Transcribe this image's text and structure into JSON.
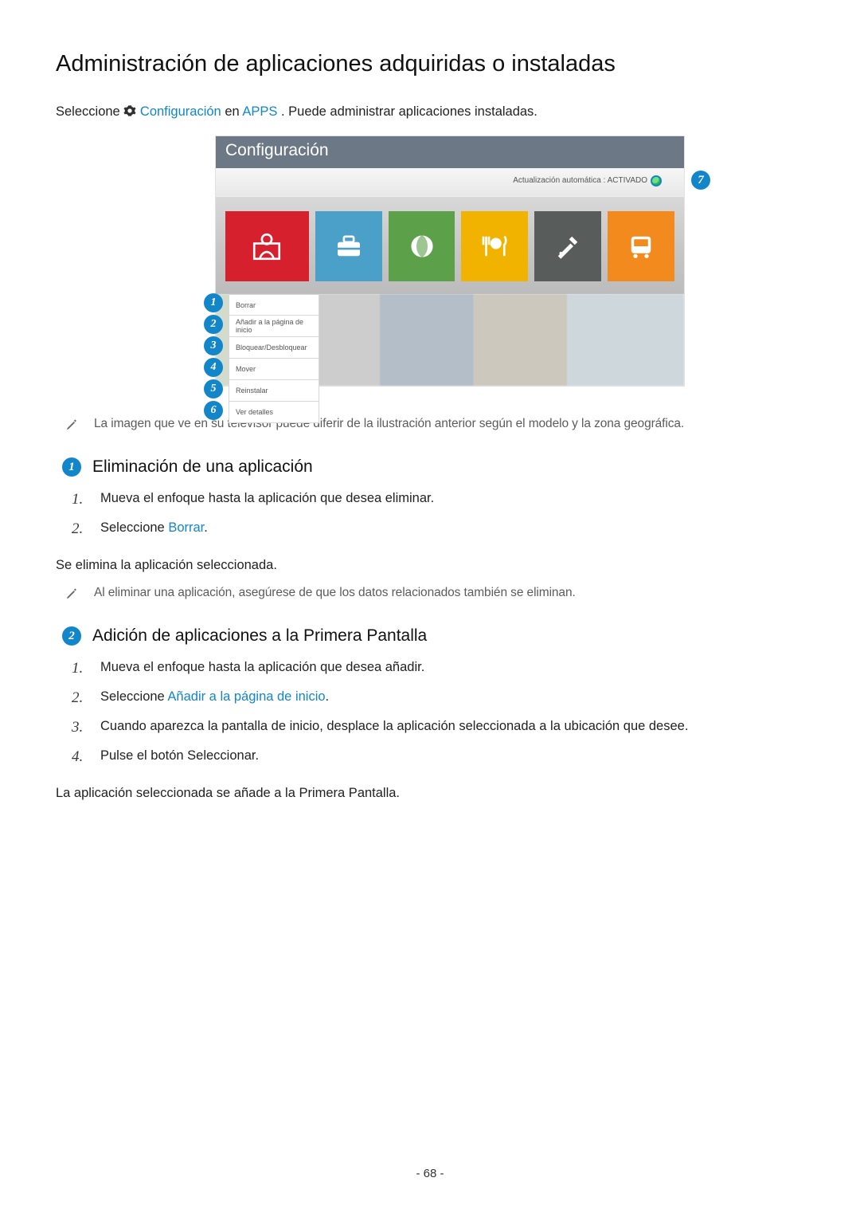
{
  "title": "Administración de aplicaciones adquiridas o instaladas",
  "intro": {
    "t1": "Seleccione ",
    "link1": "Configuración",
    "t2": " en ",
    "link2": "APPS",
    "t3": ". Puede administrar aplicaciones instaladas."
  },
  "tv": {
    "header": "Configuración",
    "auto_update": "Actualización automática : ACTIVADO",
    "context_menu": [
      "Borrar",
      "Añadir a la página de inicio",
      "Bloquear/Desbloquear",
      "Mover",
      "Reinstalar",
      "Ver detalles"
    ]
  },
  "badges": {
    "b1": "1",
    "b2": "2",
    "b3": "3",
    "b4": "4",
    "b5": "5",
    "b6": "6",
    "b7": "7"
  },
  "note1": "La imagen que ve en su televisor puede diferir de la ilustración anterior según el modelo y la zona geográfica.",
  "section1": {
    "heading": "Eliminación de una aplicación",
    "steps": {
      "s1": "Mueva el enfoque hasta la aplicación que desea eliminar.",
      "s2a": "Seleccione ",
      "s2b": "Borrar",
      "s2c": "."
    },
    "after": "Se elimina la aplicación seleccionada.",
    "note": "Al eliminar una aplicación, asegúrese de que los datos relacionados también se eliminan."
  },
  "section2": {
    "heading": "Adición de aplicaciones a la Primera Pantalla",
    "steps": {
      "s1": "Mueva el enfoque hasta la aplicación que desea añadir.",
      "s2a": "Seleccione ",
      "s2b": "Añadir a la página de inicio",
      "s2c": ".",
      "s3": "Cuando aparezca la pantalla de inicio, desplace la aplicación seleccionada a la ubicación que desee.",
      "s4": "Pulse el botón Seleccionar."
    },
    "after": "La aplicación seleccionada se añade a la Primera Pantalla."
  },
  "page_number": "- 68 -"
}
